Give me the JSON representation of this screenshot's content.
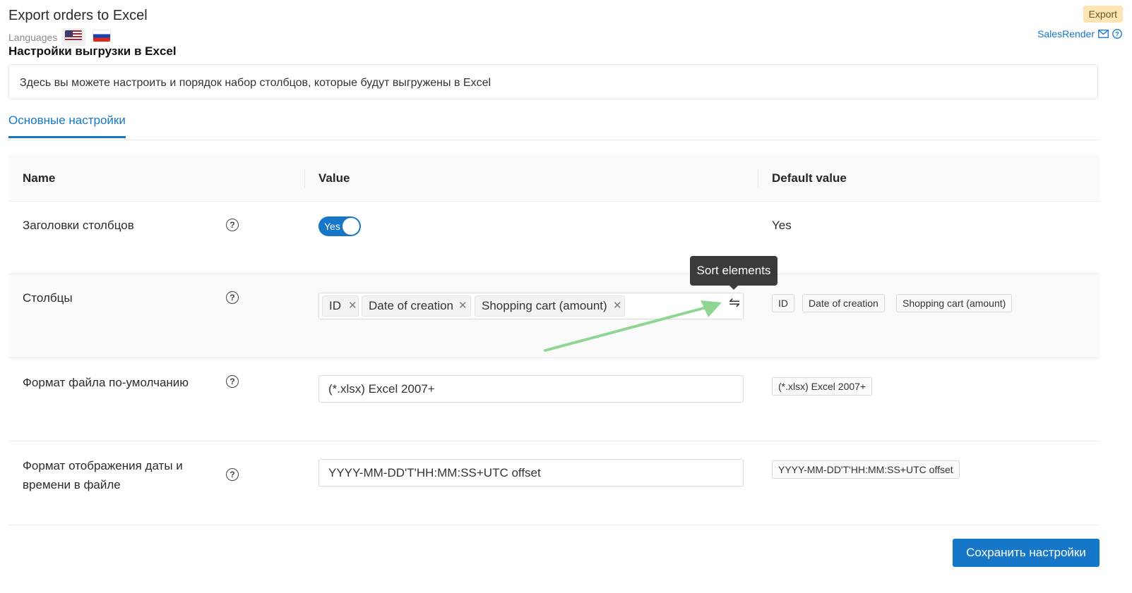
{
  "header": {
    "app_title": "Export orders to Excel",
    "languages_label": "Languages",
    "languages": [
      "en",
      "ru"
    ],
    "export_badge": "Export",
    "brand": "SalesRender",
    "icons": [
      "mail-icon",
      "help-circle-icon"
    ]
  },
  "settings": {
    "title": "Настройки выгрузки в Excel",
    "description": "Здесь вы можете настроить и порядок набор столбцов, которые будут выгружены в Excel"
  },
  "tabs": [
    {
      "label": "Основные настройки",
      "active": true
    }
  ],
  "table": {
    "headers": {
      "name": "Name",
      "value": "Value",
      "default": "Default value"
    },
    "rows": {
      "headers_row": {
        "name": "Заголовки столбцов",
        "toggle_label": "Yes",
        "default": "Yes"
      },
      "columns_row": {
        "name": "Столбцы",
        "chips": [
          "ID",
          "Date of creation",
          "Shopping cart (amount)"
        ],
        "sort_icon": "⇋",
        "defaults": [
          "ID",
          "Date of creation",
          "Shopping cart (amount)"
        ]
      },
      "format_row": {
        "name": "Формат файла по-умолчанию",
        "value": "(*.xlsx) Excel 2007+",
        "default": "(*.xlsx) Excel 2007+"
      },
      "date_row": {
        "name_line1": "Формат отображения даты и",
        "name_line2": "времени в файле",
        "value": "YYYY-MM-DD'T'HH:MM:SS+UTC offset",
        "default": "YYYY-MM-DD'T'HH:MM:SS+UTC offset"
      }
    },
    "help_glyph": "?"
  },
  "tooltip": {
    "text": "Sort elements"
  },
  "save_button": "Сохранить настройки",
  "colors": {
    "accent": "#1677c9",
    "badge_bg": "#fbe6b3",
    "tooltip_bg": "#3b3b3b",
    "arrow": "#8fd694"
  }
}
